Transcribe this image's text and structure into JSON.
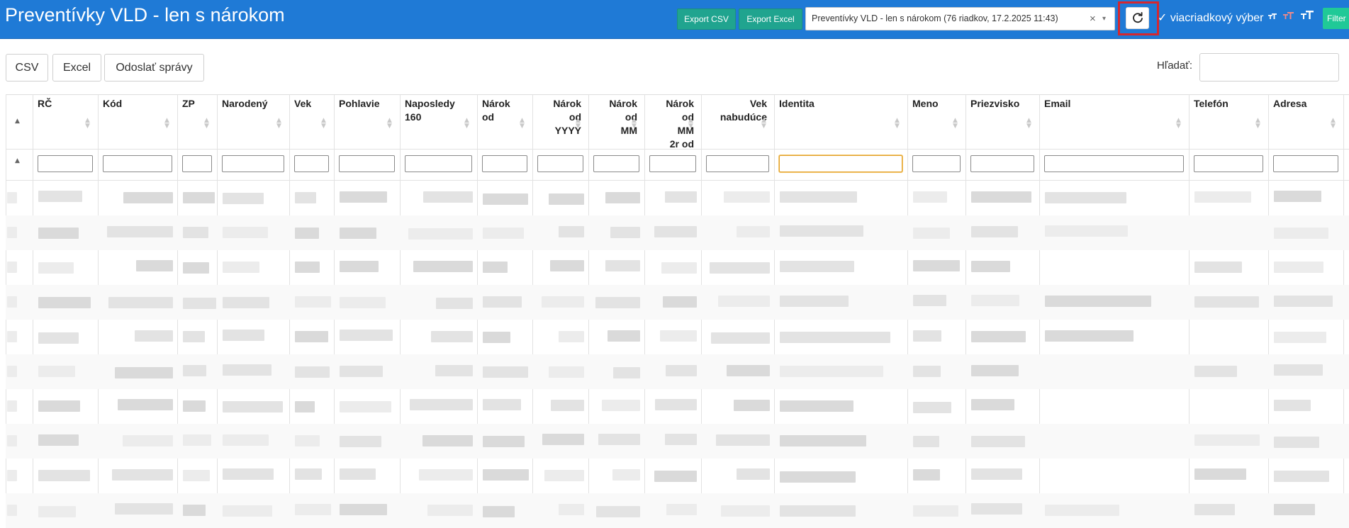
{
  "header": {
    "title": "Preventívky VLD - len s nárokom",
    "export_csv": "Export CSV",
    "export_excel": "Export Excel",
    "preset_value": "Preventívky VLD - len s nárokom (76 riadkov, 17.2.2025 11:43)",
    "clear_glyph": "×",
    "caret_glyph": "▾",
    "multirow_label": "✓ viacriadkový výber",
    "filter_label": "Filter",
    "icons": [
      "refresh-icon",
      "font-size-small-icon",
      "font-size-medium-icon",
      "font-size-large-icon"
    ],
    "accent_color": "#1f7ad6",
    "button_color": "#20a48f",
    "highlight_color": "#d6272e"
  },
  "toolbar": {
    "csv": "CSV",
    "excel": "Excel",
    "send": "Odoslať správy",
    "search_label": "Hľadať:",
    "search_value": ""
  },
  "table": {
    "sort_glyph": "▲",
    "columns": [
      [
        "RČ"
      ],
      [
        "Kód"
      ],
      [
        "ZP"
      ],
      [
        "Narodený"
      ],
      [
        "Vek"
      ],
      [
        "Pohlavie"
      ],
      [
        "Naposledy",
        "160"
      ],
      [
        "Nárok",
        "od"
      ],
      [
        "Nárok",
        "od",
        "YYYY"
      ],
      [
        "Nárok",
        "od",
        "MM"
      ],
      [
        "Nárok",
        "od",
        "MM",
        "2r od"
      ],
      [
        "Vek",
        "nabudúce"
      ],
      [
        "Identita"
      ],
      [
        "Meno"
      ],
      [
        "Priezvisko"
      ],
      [
        "Email"
      ],
      [
        "Telefón"
      ],
      [
        "Adresa"
      ]
    ],
    "filter_values": [
      "",
      "",
      "",
      "",
      "",
      "",
      "",
      "",
      "",
      "",
      "",
      "",
      "",
      "",
      "",
      "",
      "",
      ""
    ],
    "row_count_visible": 10
  }
}
